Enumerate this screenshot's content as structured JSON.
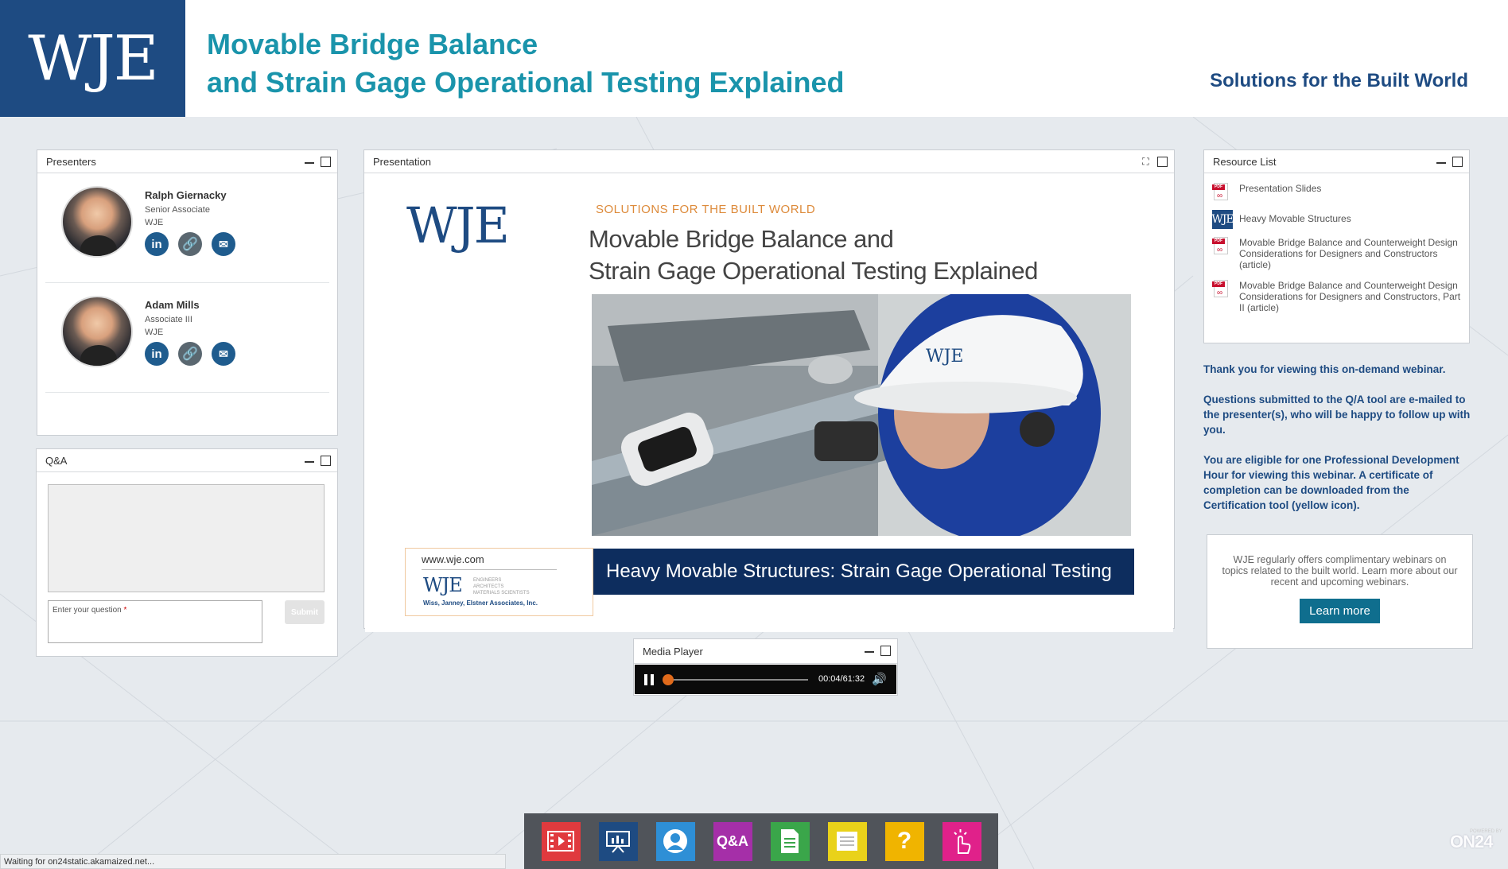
{
  "header": {
    "logo": "WJE",
    "title_line1": "Movable Bridge Balance",
    "title_line2": "and Strain Gage Operational Testing Explained",
    "tagline": "Solutions for the Built World"
  },
  "presenters_panel": {
    "title": "Presenters",
    "presenters": [
      {
        "name": "Ralph Giernacky",
        "role": "Senior Associate",
        "org": "WJE"
      },
      {
        "name": "Adam Mills",
        "role": "Associate III",
        "org": "WJE"
      }
    ]
  },
  "qa_panel": {
    "title": "Q&A",
    "input_placeholder": "Enter your question",
    "required_mark": "*",
    "submit_label": "Submit"
  },
  "presentation_panel": {
    "title": "Presentation",
    "slide": {
      "logo": "WJE",
      "tagline": "SOLUTIONS FOR THE BUILT WORLD",
      "title_line1": "Movable Bridge Balance and",
      "title_line2": "Strain Gage Operational Testing Explained",
      "hardhat_text": "WJE",
      "footer_url": "www.wje.com",
      "footer_logo": "WJE",
      "footer_sub1": "ENGINEERS",
      "footer_sub2": "ARCHITECTS",
      "footer_sub3": "MATERIALS SCIENTISTS",
      "footer_firm": "Wiss, Janney, Elstner Associates, Inc.",
      "banner": "Heavy Movable Structures: Strain Gage Operational Testing"
    }
  },
  "resource_panel": {
    "title": "Resource List",
    "items": [
      {
        "label": "Presentation Slides",
        "icon": "pdf-icon"
      },
      {
        "label": "Heavy Movable Structures",
        "icon": "wje-logo-icon"
      },
      {
        "label": "Movable Bridge Balance and Counterweight Design Considerations for Designers and Constructors (article)",
        "icon": "pdf-icon"
      },
      {
        "label": "Movable Bridge Balance and Counterweight Design Considerations for Designers and Constructors, Part II (article)",
        "icon": "pdf-icon"
      }
    ]
  },
  "info": {
    "thanks": "Thank you for viewing this on-demand webinar.",
    "questions": "Questions submitted to the Q/A tool are e-mailed to the presenter(s), who will be happy to follow up with you.",
    "eligible": "You are eligible for one Professional Development Hour for viewing this webinar. A certificate of completion can be downloaded from the Certification tool (yellow icon)."
  },
  "promo": {
    "text": "WJE regularly offers complimentary webinars on topics related to the built world. Learn more about our recent and upcoming webinars.",
    "button": "Learn more"
  },
  "media_player": {
    "title": "Media Player",
    "time": "00:04/61:32",
    "progress": 0.001
  },
  "dock": {
    "items": [
      {
        "name": "media-player",
        "color": "#e03a3e"
      },
      {
        "name": "slides",
        "color": "#1e4b82"
      },
      {
        "name": "presenters",
        "color": "#2e8fd6"
      },
      {
        "name": "qa",
        "color": "#a52fa8",
        "label": "Q&A"
      },
      {
        "name": "resources",
        "color": "#3aa64a"
      },
      {
        "name": "notes",
        "color": "#e9d21a"
      },
      {
        "name": "help",
        "color": "#f0b400",
        "label": "?"
      },
      {
        "name": "certificate",
        "color": "#e0218a"
      }
    ]
  },
  "status_bar": "Waiting for on24static.akamaized.net...",
  "branding": {
    "sub": "POWERED BY",
    "main": "ON24"
  }
}
